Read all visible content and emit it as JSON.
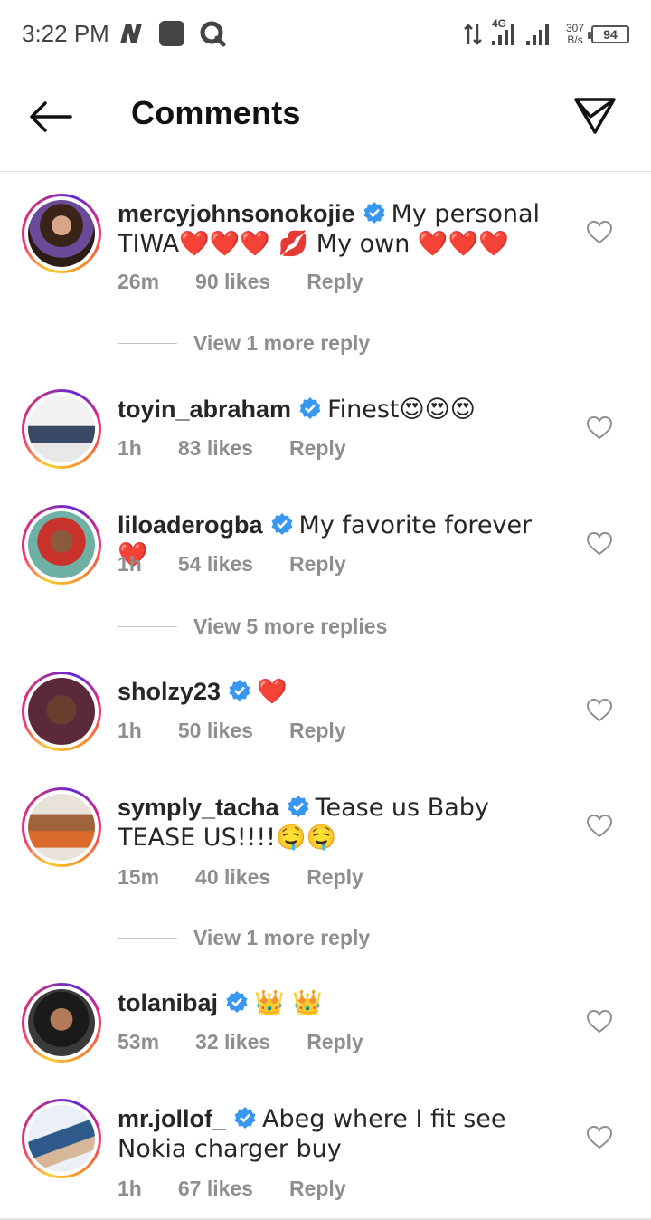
{
  "status_bar": {
    "time": "3:22 PM",
    "network": "4G",
    "speed_value": "307",
    "speed_unit": "B/s",
    "battery": "94",
    "icons": [
      "n-logo-icon",
      "gallery-icon",
      "search-app-icon",
      "data-arrows-icon",
      "signal-icon"
    ]
  },
  "header": {
    "title": "Comments",
    "back_icon": "arrow-left-icon",
    "share_icon": "paper-plane-icon"
  },
  "comments": [
    {
      "username": "mercyjohnsonokojie",
      "verified": true,
      "text": "My personal TIWA❤️❤️❤️ 💋 My own ❤️❤️❤️",
      "time": "26m",
      "likes": "90 likes",
      "reply": "Reply",
      "view_replies": "View 1 more reply"
    },
    {
      "username": "toyin_abraham",
      "verified": true,
      "text": "Finest😍😍😍",
      "time": "1h",
      "likes": "83 likes",
      "reply": "Reply"
    },
    {
      "username": "liloaderogba",
      "verified": true,
      "text": "My favorite forever ❤️",
      "time": "1h",
      "likes": "54 likes",
      "reply": "Reply",
      "view_replies": "View 5 more replies"
    },
    {
      "username": "sholzy23",
      "verified": true,
      "text": "❤️",
      "time": "1h",
      "likes": "50 likes",
      "reply": "Reply"
    },
    {
      "username": "symply_tacha",
      "verified": true,
      "text": "Tease us Baby TEASE US!!!!🤤🤤",
      "time": "15m",
      "likes": "40 likes",
      "reply": "Reply",
      "view_replies": "View 1 more reply"
    },
    {
      "username": "tolanibaj",
      "verified": true,
      "text": "👑 👑",
      "time": "53m",
      "likes": "32 likes",
      "reply": "Reply"
    },
    {
      "username": "mr.jollof_",
      "verified": true,
      "text": "Abeg where I fit see Nokia charger buy",
      "time": "1h",
      "likes": "67 likes",
      "reply": "Reply"
    }
  ],
  "colors": {
    "verified_blue": "#3897f0",
    "meta_gray": "#8e8e8e",
    "text_dark": "#262626"
  }
}
